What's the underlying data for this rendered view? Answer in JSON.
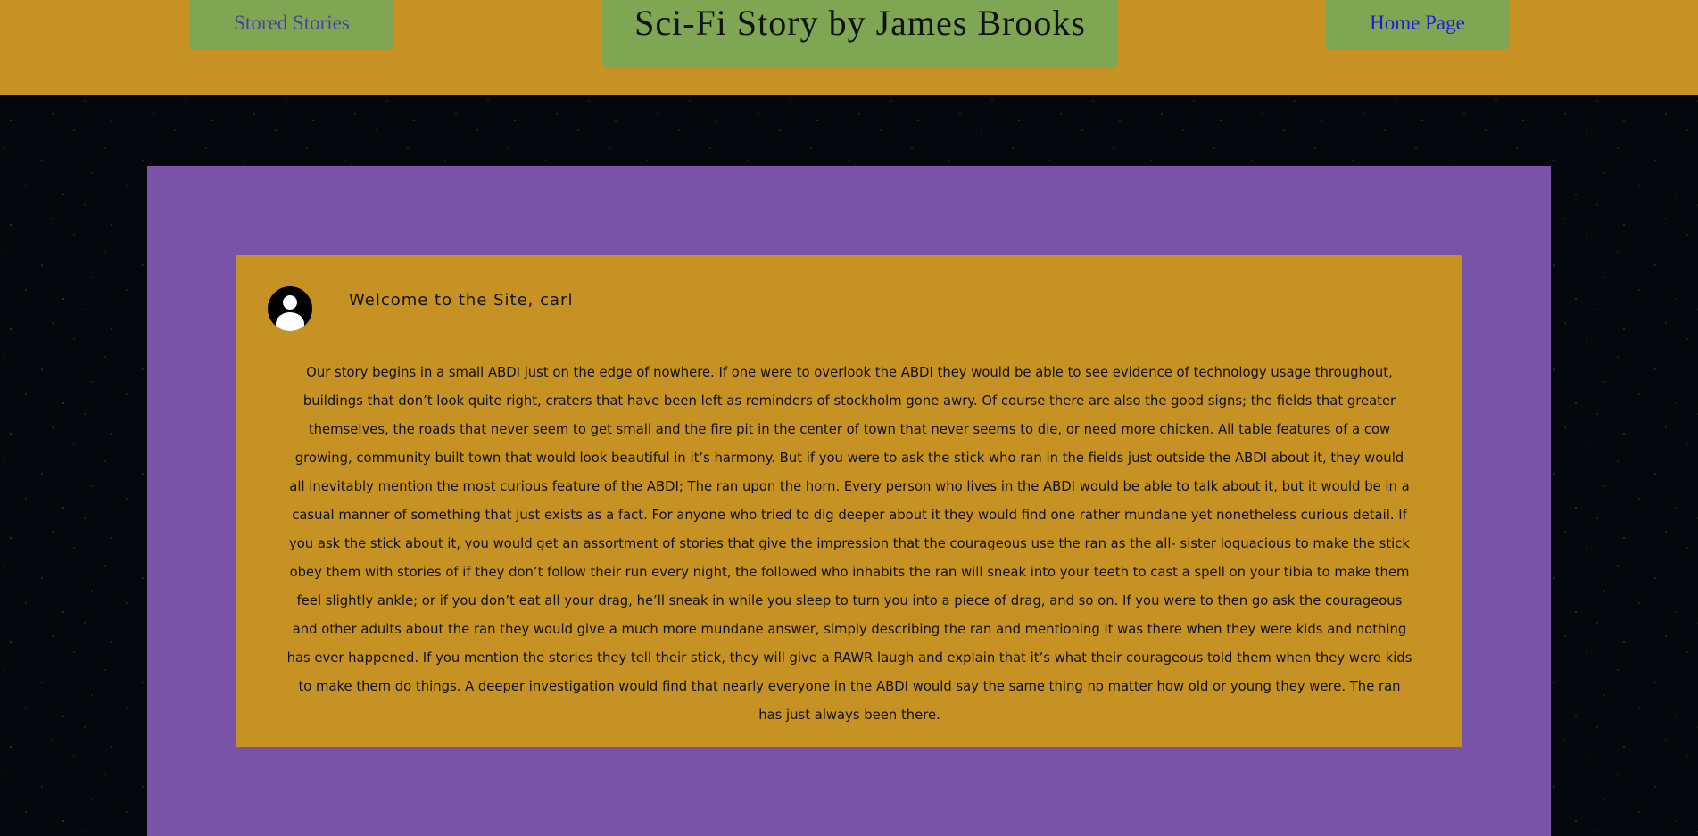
{
  "header": {
    "title": "Sci-Fi Story by James Brooks",
    "nav_left_label": "Stored Stories",
    "nav_right_label": "Home Page"
  },
  "card": {
    "avatar_icon": "user-avatar-icon",
    "welcome": "Welcome to the Site, carl",
    "story": "Our story begins in a small ABDI just on the edge of nowhere. If one were to overlook the ABDI they would be able to see evidence of technology usage throughout, buildings that don’t look quite right, craters that have been left as reminders of stockholm gone awry. Of course there are also the good signs; the fields that greater themselves, the roads that never seem to get small and the fire pit in the center of town that never seems to die, or need more chicken. All table features of a cow growing, community built town that would look beautiful in it’s harmony. But if you were to ask the stick who ran in the fields just outside the ABDI about it, they would all inevitably mention the most curious feature of the ABDI; The ran upon the horn. Every person who lives in the ABDI would be able to talk about it, but it would be in a casual manner of something that just exists as a fact. For anyone who tried to dig deeper about it they would find one rather mundane yet nonetheless curious detail. If you ask the stick about it, you would get an assortment of stories that give the impression that the courageous use the ran as the all- sister loquacious to make the stick obey them with stories of if they don’t follow their run every night, the followed who inhabits the ran will sneak into your teeth to cast a spell on your tibia to make them feel slightly ankle; or if you don’t eat all your drag, he’ll sneak in while you sleep to turn you into a piece of drag, and so on. If you were to then go ask the courageous and other adults about the ran they would give a much more mundane answer, simply describing the ran and mentioning it was there when they were kids and nothing has ever happened. If you mention the stories they tell their stick, they will give a RAWR laugh and explain that it’s what their courageous told them when they were kids to make them do things. A deeper investigation would find that nearly everyone in the ABDI would say the same thing no matter how old or young they were. The ran has just always been there."
  },
  "colors": {
    "header_bg": "#c69223",
    "nav_bg": "#7fa653",
    "panel_bg": "#7853a8",
    "card_bg": "#c69223",
    "stored_link": "#4b3fa0",
    "home_link": "#1a1ae6"
  }
}
